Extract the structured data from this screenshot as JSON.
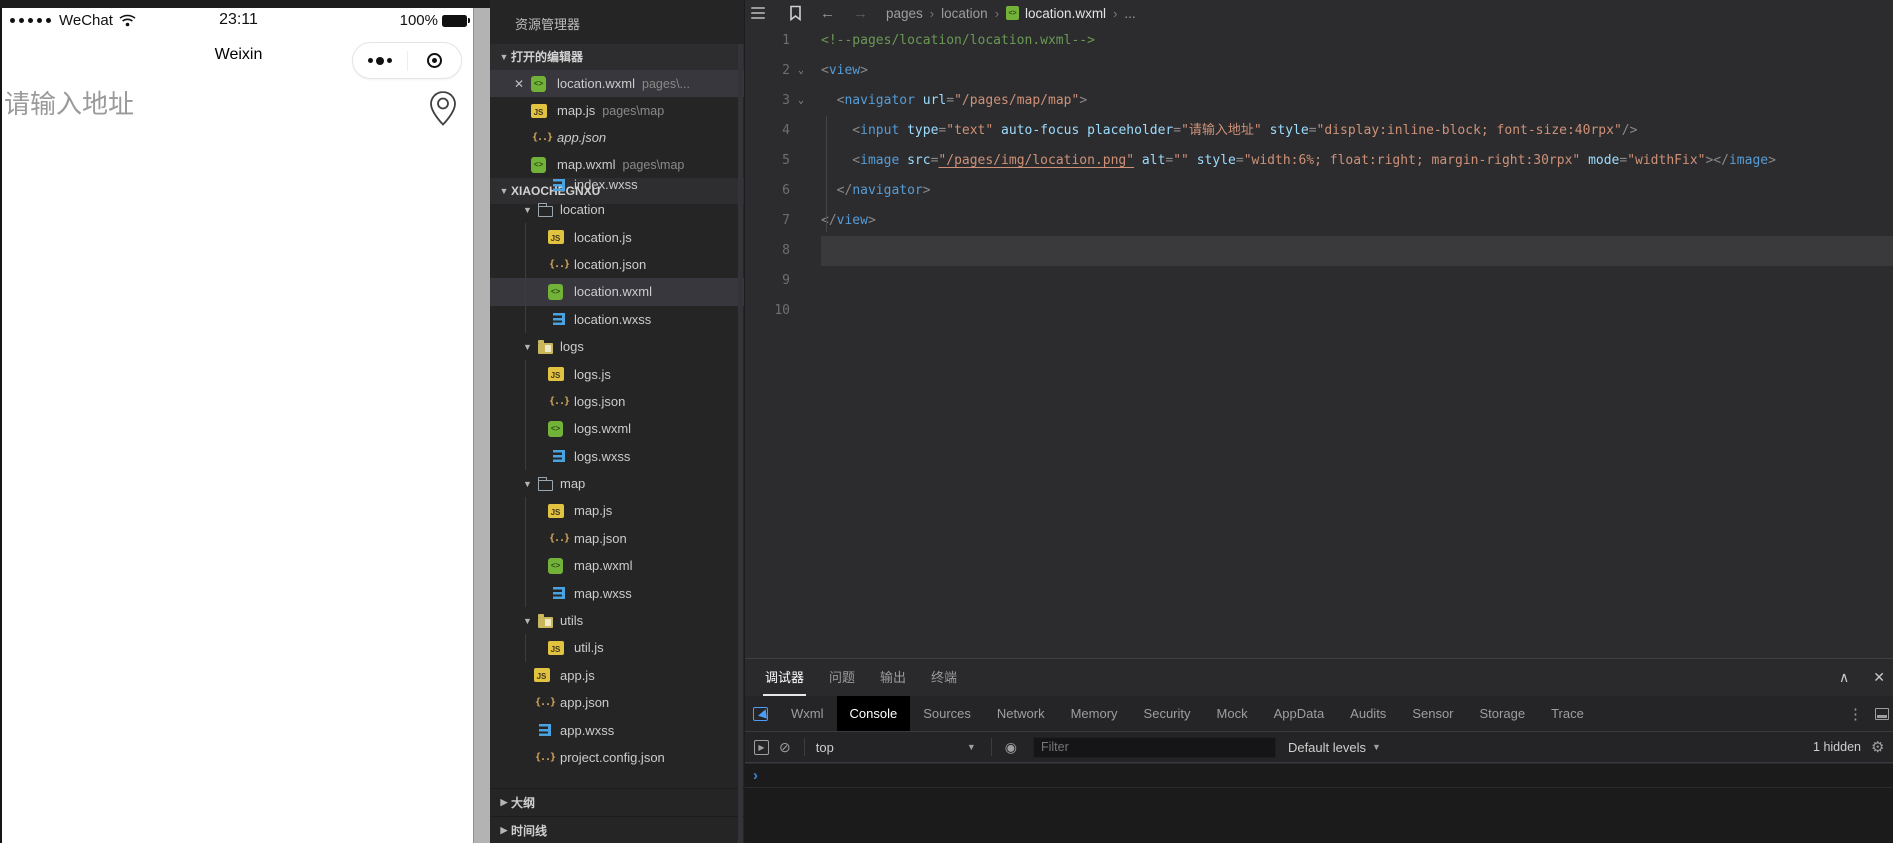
{
  "phone": {
    "status": {
      "carrier": "WeChat",
      "time": "23:11",
      "battery_pct": "100%"
    },
    "nav": {
      "title": "Weixin"
    },
    "content": {
      "address_placeholder": "请输入地址"
    }
  },
  "explorer": {
    "title": "资源管理器",
    "open_editors": {
      "header": "打开的编辑器",
      "items": [
        {
          "name": "location.wxml",
          "path": "pages\\...",
          "icon": "wxml",
          "selected": true,
          "closable": true
        },
        {
          "name": "map.js",
          "path": "pages\\map",
          "icon": "js"
        },
        {
          "name": "app.json",
          "path": "",
          "icon": "json",
          "italic": true
        },
        {
          "name": "map.wxml",
          "path": "pages\\map",
          "icon": "wxml"
        }
      ]
    },
    "project": {
      "header": "XIAOCHEGNXU",
      "items": [
        {
          "label": "index.wxss",
          "icon": "wxss",
          "level": 2,
          "clipped": true
        },
        {
          "label": "location",
          "icon": "folder-gray",
          "level": 1,
          "folder": true,
          "expanded": true
        },
        {
          "label": "location.js",
          "icon": "js",
          "level": 2,
          "guide": true
        },
        {
          "label": "location.json",
          "icon": "json",
          "level": 2,
          "guide": true
        },
        {
          "label": "location.wxml",
          "icon": "wxml",
          "level": 2,
          "guide": true,
          "selected": true
        },
        {
          "label": "location.wxss",
          "icon": "wxss",
          "level": 2,
          "guide": true
        },
        {
          "label": "logs",
          "icon": "folder-khaki",
          "level": 1,
          "folder": true,
          "expanded": true
        },
        {
          "label": "logs.js",
          "icon": "js",
          "level": 2,
          "guide": true
        },
        {
          "label": "logs.json",
          "icon": "json",
          "level": 2,
          "guide": true
        },
        {
          "label": "logs.wxml",
          "icon": "wxml",
          "level": 2,
          "guide": true
        },
        {
          "label": "logs.wxss",
          "icon": "wxss",
          "level": 2,
          "guide": true
        },
        {
          "label": "map",
          "icon": "folder-gray",
          "level": 1,
          "folder": true,
          "expanded": true
        },
        {
          "label": "map.js",
          "icon": "js",
          "level": 2,
          "guide": true
        },
        {
          "label": "map.json",
          "icon": "json",
          "level": 2,
          "guide": true
        },
        {
          "label": "map.wxml",
          "icon": "wxml",
          "level": 2,
          "guide": true
        },
        {
          "label": "map.wxss",
          "icon": "wxss",
          "level": 2,
          "guide": true
        },
        {
          "label": "utils",
          "icon": "folder-khaki",
          "level": 1,
          "folder": true,
          "expanded": true
        },
        {
          "label": "util.js",
          "icon": "js",
          "level": 2,
          "guide": true
        },
        {
          "label": "app.js",
          "icon": "js",
          "level": 1
        },
        {
          "label": "app.json",
          "icon": "json",
          "level": 1
        },
        {
          "label": "app.wxss",
          "icon": "wxss",
          "level": 1
        },
        {
          "label": "project.config.json",
          "icon": "json",
          "level": 1,
          "clipped": true
        }
      ]
    },
    "outline_header": "大纲",
    "timeline_header": "时间线"
  },
  "editor": {
    "breadcrumbs": [
      "pages",
      "location",
      "location.wxml",
      "..."
    ],
    "lines": [
      {
        "n": 1,
        "tokens": [
          [
            "c",
            "<!--pages/location/location.wxml-->"
          ]
        ]
      },
      {
        "n": 2,
        "fold": true,
        "tokens": [
          [
            "p",
            "<"
          ],
          [
            "t",
            "view"
          ],
          [
            "p",
            ">"
          ]
        ]
      },
      {
        "n": 3,
        "fold": true,
        "tokens": [
          [
            "p",
            "  <"
          ],
          [
            "t",
            "navigator"
          ],
          [
            "x",
            " "
          ],
          [
            "a",
            "url"
          ],
          [
            "p",
            "="
          ],
          [
            "s",
            "\"/pages/map/map\""
          ],
          [
            "p",
            ">"
          ]
        ]
      },
      {
        "n": 4,
        "tokens": [
          [
            "p",
            "    <"
          ],
          [
            "t",
            "input"
          ],
          [
            "x",
            " "
          ],
          [
            "a",
            "type"
          ],
          [
            "p",
            "="
          ],
          [
            "s",
            "\"text\""
          ],
          [
            "x",
            " "
          ],
          [
            "a",
            "auto-focus"
          ],
          [
            "x",
            " "
          ],
          [
            "a",
            "placeholder"
          ],
          [
            "p",
            "="
          ],
          [
            "s",
            "\"请输入地址\""
          ],
          [
            "x",
            " "
          ],
          [
            "a",
            "style"
          ],
          [
            "p",
            "="
          ],
          [
            "s",
            "\"display:inline-block; font-size:40rpx\""
          ],
          [
            "p",
            "/>"
          ]
        ]
      },
      {
        "n": 5,
        "tokens": [
          [
            "p",
            "    <"
          ],
          [
            "t",
            "image"
          ],
          [
            "x",
            " "
          ],
          [
            "a",
            "src"
          ],
          [
            "p",
            "="
          ],
          [
            "l",
            "\"/pages/img/location.png\""
          ],
          [
            "x",
            " "
          ],
          [
            "a",
            "alt"
          ],
          [
            "p",
            "="
          ],
          [
            "s",
            "\"\""
          ],
          [
            "x",
            " "
          ],
          [
            "a",
            "style"
          ],
          [
            "p",
            "="
          ],
          [
            "s",
            "\"width:6%; float:right; margin-right:30rpx\""
          ],
          [
            "x",
            " "
          ],
          [
            "a",
            "mode"
          ],
          [
            "p",
            "="
          ],
          [
            "s",
            "\"widthFix\""
          ],
          [
            "p",
            "></"
          ],
          [
            "t",
            "image"
          ],
          [
            "p",
            ">"
          ]
        ]
      },
      {
        "n": 6,
        "tokens": [
          [
            "p",
            "  </"
          ],
          [
            "t",
            "navigator"
          ],
          [
            "p",
            ">"
          ]
        ]
      },
      {
        "n": 7,
        "tokens": [
          [
            "p",
            "</"
          ],
          [
            "t",
            "view"
          ],
          [
            "p",
            ">"
          ]
        ]
      },
      {
        "n": 8,
        "highlight": true,
        "tokens": []
      },
      {
        "n": 9,
        "tokens": []
      },
      {
        "n": 10,
        "tokens": []
      }
    ]
  },
  "debugger": {
    "panel_tabs": [
      {
        "label": "调试器",
        "active": true
      },
      {
        "label": "问题"
      },
      {
        "label": "输出"
      },
      {
        "label": "终端"
      }
    ],
    "devtools_tabs": [
      {
        "label": "Wxml"
      },
      {
        "label": "Console",
        "active": true
      },
      {
        "label": "Sources"
      },
      {
        "label": "Network"
      },
      {
        "label": "Memory"
      },
      {
        "label": "Security"
      },
      {
        "label": "Mock"
      },
      {
        "label": "AppData"
      },
      {
        "label": "Audits"
      },
      {
        "label": "Sensor"
      },
      {
        "label": "Storage"
      },
      {
        "label": "Trace"
      }
    ],
    "toolbar": {
      "context": "top",
      "filter_placeholder": "Filter",
      "levels": "Default levels",
      "hidden_count": "1 hidden"
    },
    "console_prompt": "›"
  },
  "colors": {
    "tag_blue": "#569CD6",
    "attr_blue": "#9CDCFE",
    "string_salmon": "#CE9178",
    "comment_green": "#6A9955",
    "selection_bg": "#37373d",
    "console_tab_bg": "#000000",
    "inspect_icon_blue": "#4a9df8",
    "wxml_icon_green": "#73b239",
    "js_icon_yellow": "#e2c341",
    "wxss_icon_blue": "#4aa3e0"
  }
}
